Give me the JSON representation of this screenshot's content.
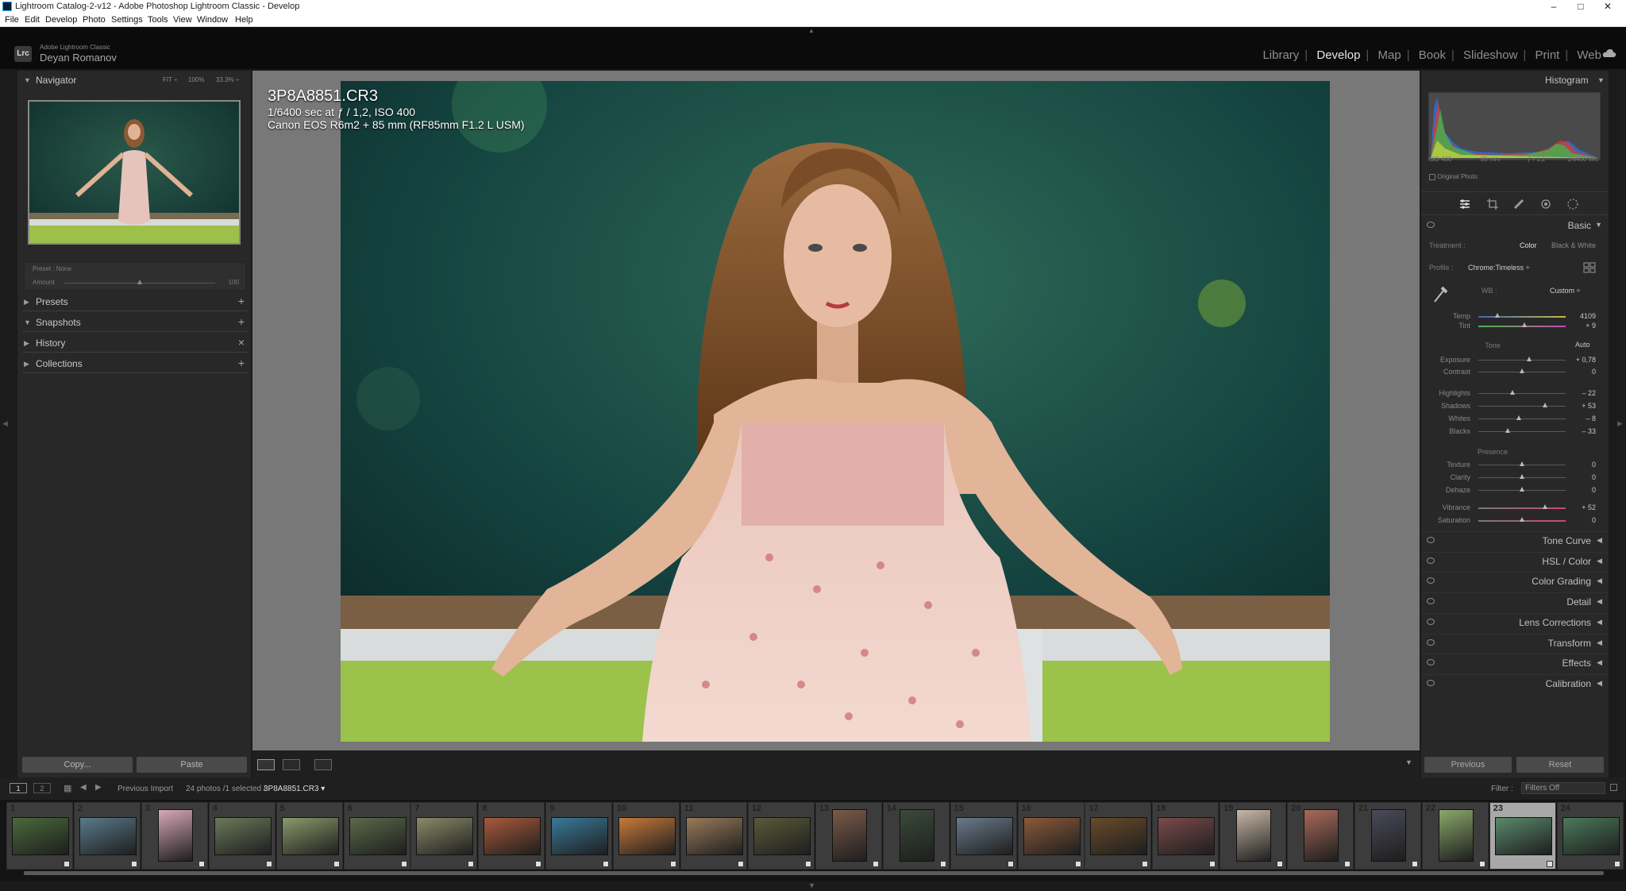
{
  "window": {
    "title": "Lightroom Catalog-2-v12 - Adobe Photoshop Lightroom Classic - Develop",
    "buttons": [
      "–",
      "□",
      "✕"
    ]
  },
  "menu": [
    "File",
    "Edit",
    "Develop",
    "Photo",
    "Settings",
    "Tools",
    "View",
    "Window",
    "Help"
  ],
  "identity": {
    "logo": "Lrc",
    "product": "Adobe Lightroom Classic",
    "user": "Deyan Romanov"
  },
  "modules": [
    "Library",
    "Develop",
    "Map",
    "Book",
    "Slideshow",
    "Print",
    "Web"
  ],
  "active_module": "Develop",
  "left_panel": {
    "navigator": {
      "label": "Navigator",
      "zoom": [
        "FIT ÷",
        "100%",
        "33.3% ÷"
      ]
    },
    "preset": {
      "preset_label": "Preset : None",
      "amount_label": "Amount",
      "amount_value": "100"
    },
    "sections": [
      {
        "label": "Presets",
        "action": "+"
      },
      {
        "label": "Snapshots",
        "action": "+"
      },
      {
        "label": "History",
        "action": "×"
      },
      {
        "label": "Collections",
        "action": "+"
      }
    ],
    "copy": "Copy...",
    "paste": "Paste"
  },
  "overlay": {
    "filename": "3P8A8851.CR3",
    "exposure": "1/6400 sec at ƒ / 1,2, ISO 400",
    "camera": "Canon EOS R6m2 + 85 mm (RF85mm F1.2 L USM)"
  },
  "right_panel": {
    "histogram": {
      "label": "Histogram",
      "info": [
        "ISO 400",
        "85 mm",
        "ƒ / 1,2",
        "1/6400 sec"
      ],
      "original": "Original Photo"
    },
    "basic": {
      "label": "Basic",
      "treatment_label": "Treatment :",
      "treatment_color": "Color",
      "treatment_bw": "Black & White",
      "profile_label": "Profile :",
      "profile_value": "Chrome:Timeless ÷",
      "wb_label": "WB :",
      "wb_value": "Custom ÷",
      "tone_label": "Tone",
      "auto_label": "Auto",
      "presence_label": "Presence",
      "sliders": [
        {
          "name": "Temp",
          "value": "4109",
          "pos": 0.22
        },
        {
          "name": "Tint",
          "value": "+ 9",
          "pos": 0.53
        },
        {
          "name": "Exposure",
          "value": "+ 0,78",
          "pos": 0.58
        },
        {
          "name": "Contrast",
          "value": "0",
          "pos": 0.5
        },
        {
          "name": "Highlights",
          "value": "– 22",
          "pos": 0.39
        },
        {
          "name": "Shadows",
          "value": "+ 53",
          "pos": 0.76
        },
        {
          "name": "Whites",
          "value": "– 8",
          "pos": 0.46
        },
        {
          "name": "Blacks",
          "value": "– 33",
          "pos": 0.34
        },
        {
          "name": "Texture",
          "value": "0",
          "pos": 0.5
        },
        {
          "name": "Clarity",
          "value": "0",
          "pos": 0.5
        },
        {
          "name": "Dehaze",
          "value": "0",
          "pos": 0.5
        },
        {
          "name": "Vibrance",
          "value": "+ 52",
          "pos": 0.76
        },
        {
          "name": "Saturation",
          "value": "0",
          "pos": 0.5
        }
      ]
    },
    "sections": [
      "Tone Curve",
      "HSL / Color",
      "Color Grading",
      "Detail",
      "Lens Corrections",
      "Transform",
      "Effects",
      "Calibration"
    ],
    "previous": "Previous",
    "reset": "Reset"
  },
  "filmstrip": {
    "monitor1": "1",
    "monitor2": "2",
    "source": "Previous Import",
    "count": "24 photos /1 selected /",
    "current": "3P8A8851.CR3 ▾",
    "filter_label": "Filter :",
    "filter_value": "Filters Off",
    "thumbs": [
      "1",
      "2",
      "3",
      "4",
      "5",
      "6",
      "7",
      "8",
      "9",
      "10",
      "11",
      "12",
      "13",
      "14",
      "15",
      "16",
      "17",
      "18",
      "19",
      "20",
      "21",
      "22",
      "23",
      "24"
    ],
    "selected": "23"
  },
  "colors": {
    "accent": "#e6e6e6",
    "panel": "#282828",
    "background": "#1b1b1b"
  }
}
